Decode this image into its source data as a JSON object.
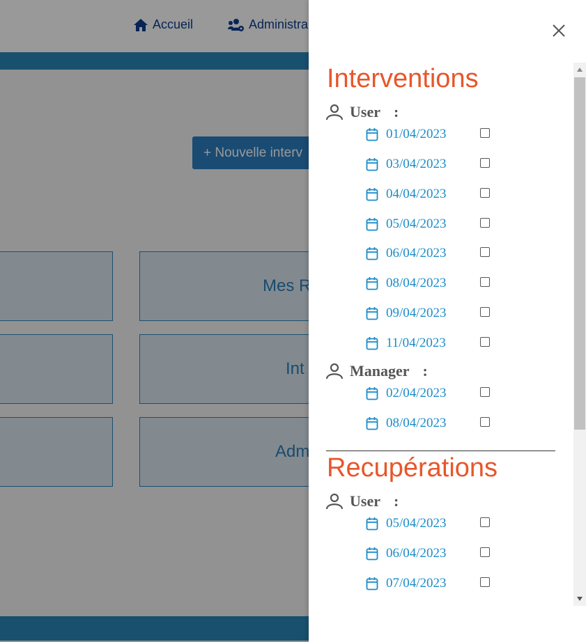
{
  "nav": {
    "home_label": "Accueil",
    "admin_label": "Administra"
  },
  "main": {
    "new_button_label": "+ Nouvelle interv",
    "tiles": [
      "Mes R",
      "Int",
      "Adm"
    ]
  },
  "drawer": {
    "interventions": {
      "title": "Interventions",
      "groups": [
        {
          "user": "User",
          "colon": ":",
          "dates": [
            "01/04/2023",
            "03/04/2023",
            "04/04/2023",
            "05/04/2023",
            "06/04/2023",
            "08/04/2023",
            "09/04/2023",
            "11/04/2023"
          ]
        },
        {
          "user": "Manager",
          "colon": ":",
          "dates": [
            "02/04/2023",
            "08/04/2023"
          ]
        }
      ]
    },
    "recuperations": {
      "title": "Recupérations",
      "groups": [
        {
          "user": "User",
          "colon": ":",
          "dates": [
            "05/04/2023",
            "06/04/2023",
            "07/04/2023"
          ]
        }
      ]
    }
  },
  "colors": {
    "accent": "#e8562a",
    "date_blue": "#1a8cc8",
    "band_blue": "#2a86b8",
    "nav_blue": "#0d3d8c"
  }
}
